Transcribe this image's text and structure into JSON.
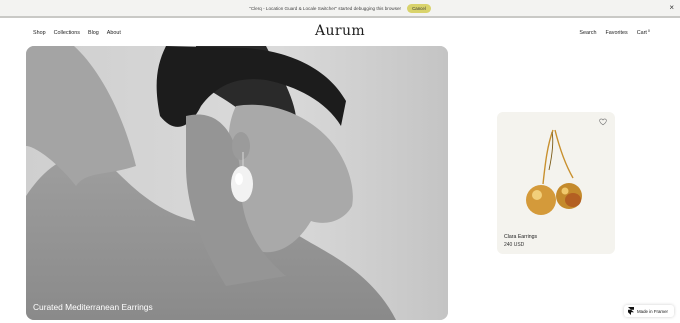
{
  "debug": {
    "message": "\"Clerq - Location Guard & Locale Switcher\" started debugging this browser",
    "cancel_label": "Cancel",
    "close_glyph": "×"
  },
  "nav": {
    "left": [
      "Shop",
      "Collections",
      "Blog",
      "About"
    ],
    "logo": "Aurum",
    "right": {
      "search": "Search",
      "favorites": "Favorites",
      "cart": "Cart",
      "cart_count": "0"
    }
  },
  "hero": {
    "caption": "Curated Mediterranean Earrings"
  },
  "product": {
    "name": "Clara Earrings",
    "price": "240 USD",
    "icon": "heart-icon"
  },
  "badge": {
    "label": "Made in Framer",
    "icon": "framer-logo-icon"
  },
  "colors": {
    "accent": "#d9d36b",
    "card_bg": "#f4f3ee",
    "gold": "#c8902e"
  }
}
